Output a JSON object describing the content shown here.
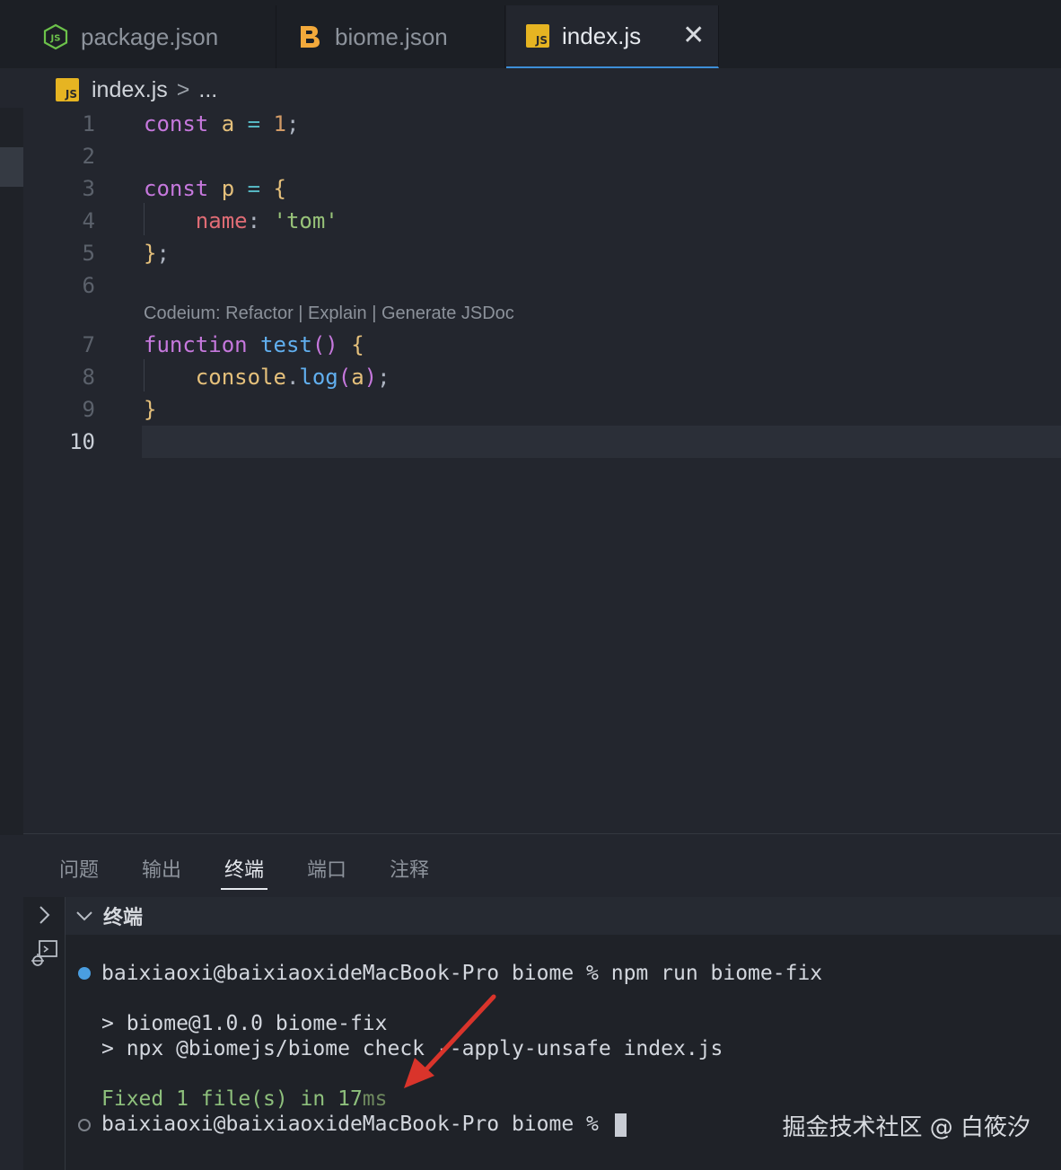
{
  "tabs": [
    {
      "label": "package.json",
      "icon": "node-icon"
    },
    {
      "label": "biome.json",
      "icon": "biome-icon"
    },
    {
      "label": "index.js",
      "icon": "js-icon",
      "active": true
    }
  ],
  "js_badge": "JS",
  "breadcrumb": {
    "file": "index.js",
    "sep": ">",
    "more": "..."
  },
  "code": {
    "line_numbers": [
      "1",
      "2",
      "3",
      "4",
      "5",
      "6",
      "7",
      "8",
      "9",
      "10"
    ],
    "codelens": "Codeium: Refactor | Explain | Generate JSDoc",
    "tokens": {
      "l1": [
        "const",
        "a",
        "=",
        "1",
        ";"
      ],
      "l3": [
        "const",
        "p",
        "=",
        "{"
      ],
      "l4": [
        "name",
        ":",
        "'tom'"
      ],
      "l5": [
        "}",
        ";"
      ],
      "l7": [
        "function",
        "test",
        "()",
        "{"
      ],
      "l8": [
        "console",
        ".",
        "log",
        "(",
        "a",
        ")",
        ";"
      ],
      "l9": [
        "}"
      ]
    }
  },
  "panel": {
    "tabs": [
      "问题",
      "输出",
      "终端",
      "端口",
      "注释"
    ],
    "active_tab": "终端",
    "terminal_title": "终端"
  },
  "terminal": {
    "prompt1": "baixiaoxi@baixiaoxideMacBook-Pro biome % npm run biome-fix",
    "out1": "> biome@1.0.0 biome-fix",
    "out2": "> npx @biomejs/biome check --apply-unsafe index.js",
    "fixed_main": "Fixed 1 file(s) in 17",
    "fixed_unit": "ms",
    "prompt2": "baixiaoxi@baixiaoxideMacBook-Pro biome %"
  },
  "watermark": "掘金技术社区 @ 白筱汐",
  "colors": {
    "accent": "#3d8ed8",
    "annotation_arrow": "#d9342b",
    "js_yellow": "#e6b422",
    "biome_orange": "#f2a93b",
    "node_green": "#6cc24a"
  }
}
